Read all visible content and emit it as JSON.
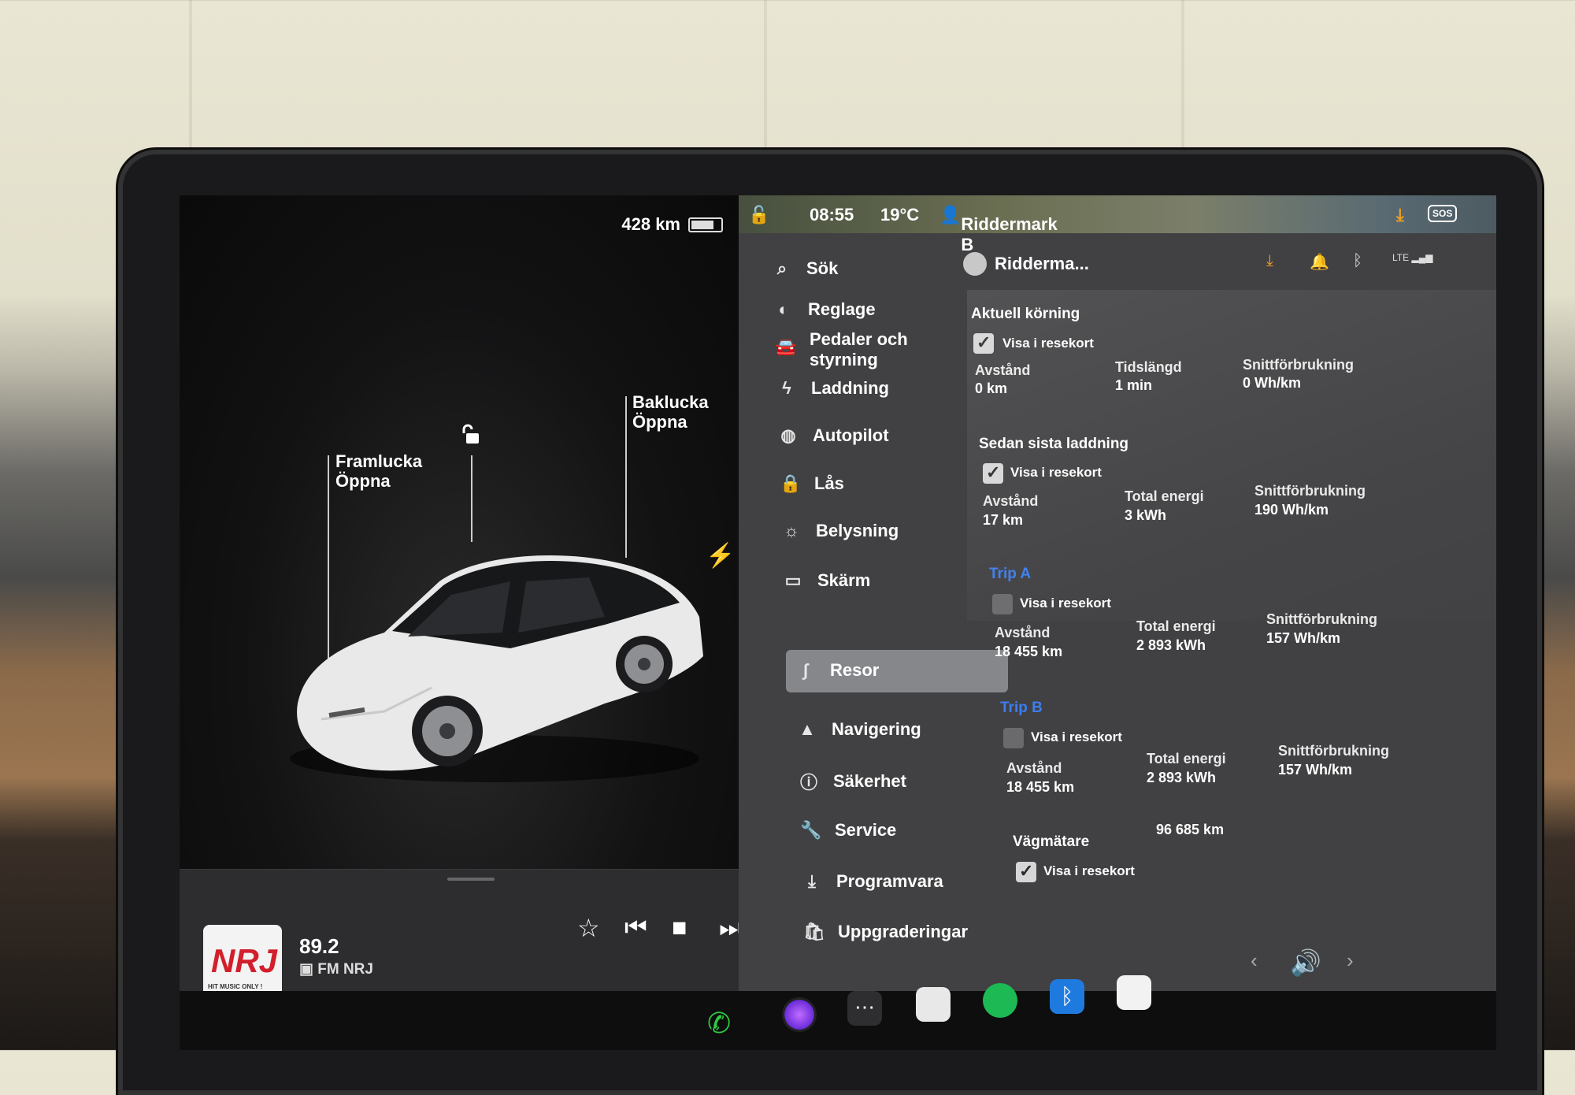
{
  "car_panel": {
    "range": "428 km",
    "front_trunk": {
      "title": "Framlucka",
      "action": "Öppna"
    },
    "rear_trunk": {
      "title": "Baklucka",
      "action": "Öppna"
    }
  },
  "media": {
    "frequency": "89.2",
    "station": "FM NRJ",
    "logo_text": "NRJ",
    "logo_tagline": "HIT MUSIC ONLY !"
  },
  "statusbar": {
    "time": "08:55",
    "temperature": "19°C",
    "profile": "Riddermark B",
    "sos": "SOS"
  },
  "sidebar": {
    "search": "Sök",
    "items": [
      {
        "label": "Reglage",
        "icon": "toggle-icon"
      },
      {
        "label": "Pedaler och styrning",
        "icon": "car-icon"
      },
      {
        "label": "Laddning",
        "icon": "bolt-icon"
      },
      {
        "label": "Autopilot",
        "icon": "steering-wheel-icon"
      },
      {
        "label": "Lås",
        "icon": "lock-icon"
      },
      {
        "label": "Belysning",
        "icon": "sun-icon"
      },
      {
        "label": "Skärm",
        "icon": "display-icon"
      },
      {
        "label": "Resor",
        "icon": "route-icon",
        "active": true
      },
      {
        "label": "Navigering",
        "icon": "navigation-arrow-icon"
      },
      {
        "label": "Säkerhet",
        "icon": "alert-circle-icon"
      },
      {
        "label": "Service",
        "icon": "wrench-icon"
      },
      {
        "label": "Programvara",
        "icon": "download-icon"
      },
      {
        "label": "Uppgraderingar",
        "icon": "shopping-bag-icon"
      }
    ]
  },
  "header": {
    "user": "Ridderma...",
    "lte": "LTE"
  },
  "trips": {
    "current": {
      "title": "Aktuell körning",
      "show_on_trip_card": {
        "label": "Visa i resekort",
        "checked": true
      },
      "distance_label": "Avstånd",
      "distance": "0 km",
      "duration_label": "Tidslängd",
      "duration": "1 min",
      "avg_label": "Snittförbrukning",
      "avg": "0 Wh/km"
    },
    "since_charge": {
      "title": "Sedan sista laddning",
      "show_on_trip_card": {
        "label": "Visa i resekort",
        "checked": true
      },
      "distance_label": "Avstånd",
      "distance": "17 km",
      "energy_label": "Total energi",
      "energy": "3 kWh",
      "avg_label": "Snittförbrukning",
      "avg": "190 Wh/km"
    },
    "trip_a": {
      "title": "Trip A",
      "show_on_trip_card": {
        "label": "Visa i resekort",
        "checked": false
      },
      "distance_label": "Avstånd",
      "distance": "18 455 km",
      "energy_label": "Total energi",
      "energy": "2 893 kWh",
      "avg_label": "Snittförbrukning",
      "avg": "157 Wh/km"
    },
    "trip_b": {
      "title": "Trip B",
      "show_on_trip_card": {
        "label": "Visa i resekort",
        "checked": false
      },
      "distance_label": "Avstånd",
      "distance": "18 455 km",
      "energy_label": "Total energi",
      "energy": "2 893 kWh",
      "avg_label": "Snittförbrukning",
      "avg": "157 Wh/km"
    },
    "odometer": {
      "title": "Vägmätare",
      "value": "96 685 km",
      "show_on_trip_card": {
        "label": "Visa i resekort",
        "checked": true
      }
    }
  },
  "colors": {
    "accent_blue": "#3d7df0",
    "download_orange": "#f0a020",
    "spotify_green": "#1db954",
    "bluetooth_blue": "#1f7ae0",
    "phone_green": "#2ecc40"
  }
}
